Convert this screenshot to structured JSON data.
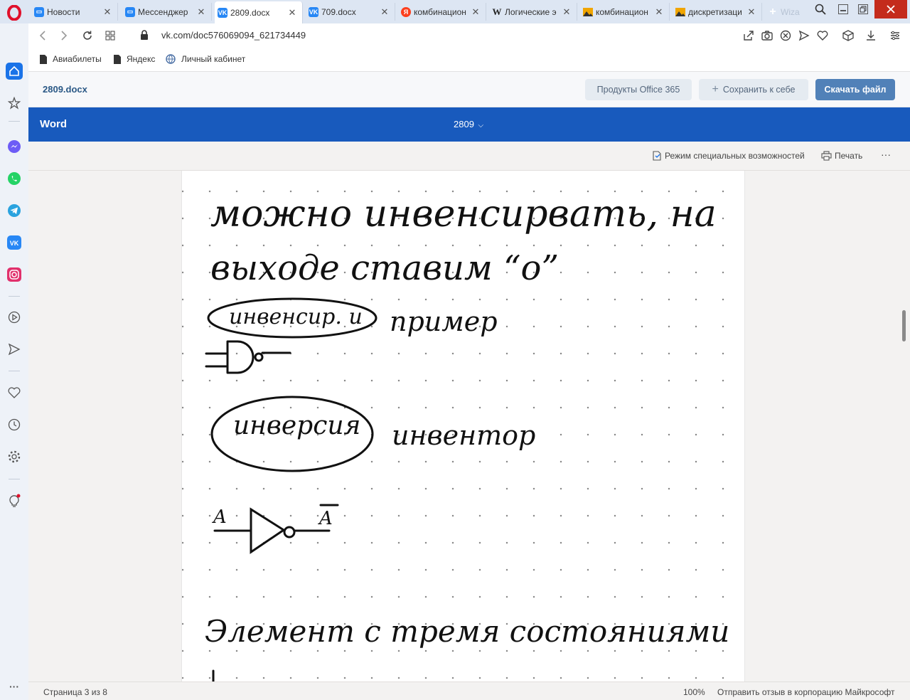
{
  "browser": {
    "tabs": [
      {
        "label": "Новости",
        "icon": "vk-messenger-icon",
        "color": "#2787f5"
      },
      {
        "label": "Мессенджер",
        "icon": "vk-messenger-icon",
        "color": "#2787f5"
      },
      {
        "label": "2809.docx",
        "icon": "vk-icon",
        "color": "#2787f5"
      },
      {
        "label": "709.docx",
        "icon": "vk-icon",
        "color": "#2787f5"
      },
      {
        "label": "комбинацион",
        "icon": "yandex-icon",
        "color": "#fc3f1d"
      },
      {
        "label": "Логические э",
        "icon": "wikipedia-icon",
        "color": "#333333"
      },
      {
        "label": "комбинацион",
        "icon": "image-icon",
        "color": "#f0a500"
      },
      {
        "label": "дискретизаци",
        "icon": "image-icon",
        "color": "#f0a500"
      },
      {
        "label": "Wiza",
        "icon": "plus-icon",
        "color": "#ffffff"
      }
    ],
    "url": "vk.com/doc576069094_621734449",
    "bookmarks": [
      "Авиабилеты",
      "Яндекс",
      "Личный кабинет"
    ]
  },
  "vk": {
    "doc_name": "2809.docx",
    "office_button": "Продукты Office 365",
    "save_button": "Сохранить к себе",
    "download_button": "Скачать файл"
  },
  "word": {
    "app_name": "Word",
    "doc_title": "2809",
    "accessibility": "Режим специальных возможностей",
    "print": "Печать",
    "more": "···",
    "handwriting": {
      "line1": "можно инвенсирвать, на",
      "line2": "выходе ставим “о”",
      "circled1": "инвенсир. и",
      "example": "пример",
      "circled2": "инверсия",
      "inverter": "инвентор",
      "input_label": "A",
      "output_label": "A",
      "line3": "Элемент с тремя состояниями"
    }
  },
  "status": {
    "page": "Страница 3 из 8",
    "zoom": "100%",
    "feedback": "Отправить отзыв в корпорацию Майкрософт"
  }
}
